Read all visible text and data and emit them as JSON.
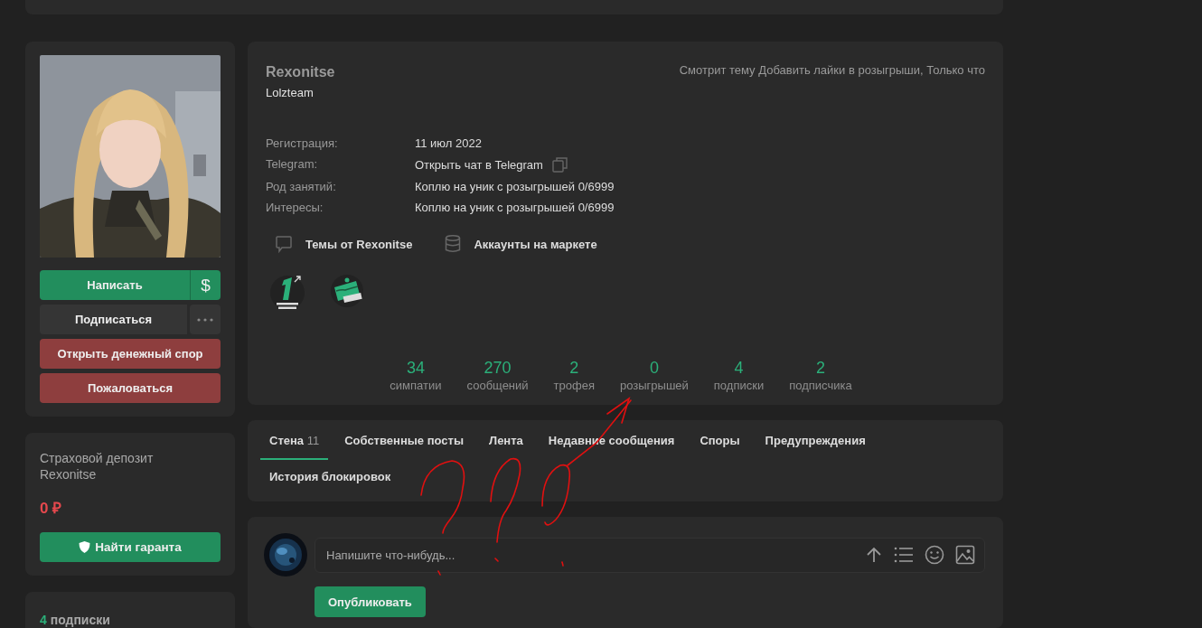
{
  "sidebar": {
    "actions": [
      {
        "label": "Написать",
        "kind": "primary",
        "extra": "$"
      },
      {
        "label": "Подписаться",
        "kind": "neutral",
        "has_menu": true
      },
      {
        "label": "Открыть денежный спор",
        "kind": "danger"
      },
      {
        "label": "Пожаловаться",
        "kind": "danger"
      }
    ],
    "deposit": {
      "title": "Страховой депозит Rexonitse",
      "amount": "0 ₽",
      "button": "Найти гаранта"
    },
    "subscriptions": {
      "count": "4",
      "label": "подписки"
    }
  },
  "profile": {
    "username": "Rexonitse",
    "group": "Lolzteam",
    "activity": "Смотрит тему Добавить лайки в розыгрыши, Только что",
    "fields": [
      {
        "label": "Регистрация:",
        "value": "11 июл 2022"
      },
      {
        "label": "Telegram:",
        "value": "Открыть чат в Telegram",
        "kind": "copy"
      },
      {
        "label": "Род занятий:",
        "value": "Коплю на уник с розыгрышей 0/6999"
      },
      {
        "label": "Интересы:",
        "value": "Коплю на уник с розыгрышей 0/6999"
      }
    ],
    "links": [
      {
        "label": "Темы от Rexonitse",
        "kind": "chat"
      },
      {
        "label": "Аккаунты на маркете",
        "kind": "database"
      }
    ],
    "trophies": [
      {
        "kind": "year"
      },
      {
        "kind": "cake"
      }
    ],
    "stats": [
      {
        "value": "34",
        "label": "симпатии"
      },
      {
        "value": "270",
        "label": "сообщений"
      },
      {
        "value": "2",
        "label": "трофея"
      },
      {
        "value": "0",
        "label": "розыгрышей"
      },
      {
        "value": "4",
        "label": "подписки"
      },
      {
        "value": "2",
        "label": "подписчика"
      }
    ]
  },
  "tabs": [
    {
      "label": "Стена",
      "count": "11",
      "selected": true
    },
    {
      "label": "Собственные посты",
      "selected": false
    },
    {
      "label": "Лента",
      "selected": false
    },
    {
      "label": "Недавние сообщения",
      "selected": false
    },
    {
      "label": "Споры",
      "selected": false
    },
    {
      "label": "Предупреждения",
      "selected": false
    },
    {
      "label": "История блокировок",
      "selected": false
    }
  ],
  "composer": {
    "placeholder": "Напишите что-нибудь...",
    "button": "Опубликовать"
  }
}
